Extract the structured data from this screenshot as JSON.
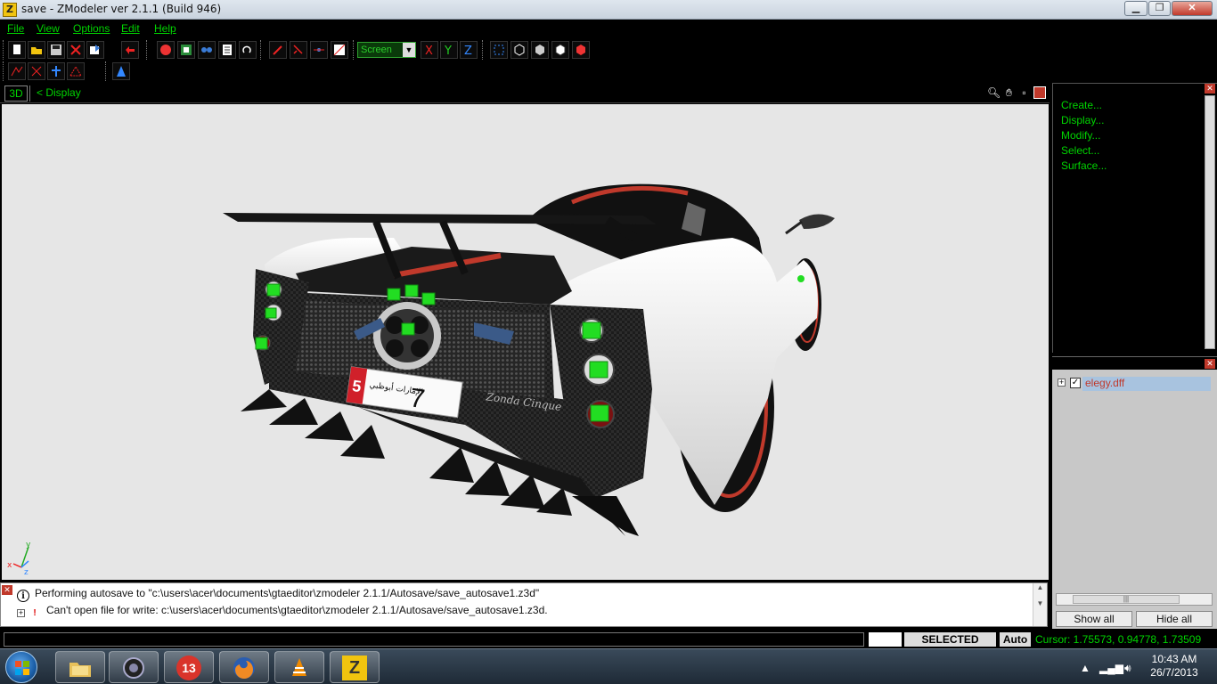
{
  "window": {
    "title": "save - ZModeler ver 2.1.1 (Build 946)",
    "icon": "Z"
  },
  "menu": {
    "items": [
      "File",
      "View",
      "Options",
      "Edit",
      "Help"
    ]
  },
  "toolbar": {
    "coord_system_selected": "Screen",
    "axis_x": "X",
    "axis_y": "Y",
    "axis_z": "Z"
  },
  "viewport": {
    "mode_label": "3D",
    "display_label": "<  Display",
    "background": "#e6e6e6"
  },
  "command_panel": {
    "items": [
      "Create...",
      "Display...",
      "Modify...",
      "Select...",
      "Surface..."
    ]
  },
  "scene_tree": {
    "expand_glyph": "+",
    "check_glyph": "✓",
    "root_item": "elegy.dff",
    "show_all_label": "Show all",
    "hide_all_label": "Hide all"
  },
  "plate": {
    "left_number": "5",
    "main_number": "7",
    "arabic_text": "الإمارات أبوظبي"
  },
  "car_badge": "Zonda Cinque",
  "axis_gizmo": {
    "x": "x",
    "y": "y",
    "z": "z"
  },
  "log": {
    "entries": [
      {
        "type": "info",
        "icon": "i",
        "text": "Performing autosave to \"c:\\users\\acer\\documents\\gtaeditor\\zmodeler 2.1.1/Autosave/save_autosave1.z3d\""
      },
      {
        "type": "error",
        "icon": "!",
        "text": "Can't open file for write: c:\\users\\acer\\documents\\gtaeditor\\zmodeler 2.1.1/Autosave/save_autosave1.z3d."
      }
    ]
  },
  "status": {
    "mode": "SELECTED MODE",
    "auto": "Auto",
    "cursor": "Cursor: 1.75573, 0.94778, 1.73509"
  },
  "taskbar": {
    "apps": [
      "explorer",
      "tcl-app",
      "13-app",
      "firefox",
      "vlc",
      "zmodeler"
    ],
    "app_13_label": "13",
    "zmodeler_label": "Z",
    "clock_time": "10:43 AM",
    "clock_date": "26/7/2013"
  },
  "colors": {
    "menu_text": "#00d400",
    "panel_bg": "#000000",
    "accent_red": "#d00000",
    "selection": "#a8c3df"
  }
}
